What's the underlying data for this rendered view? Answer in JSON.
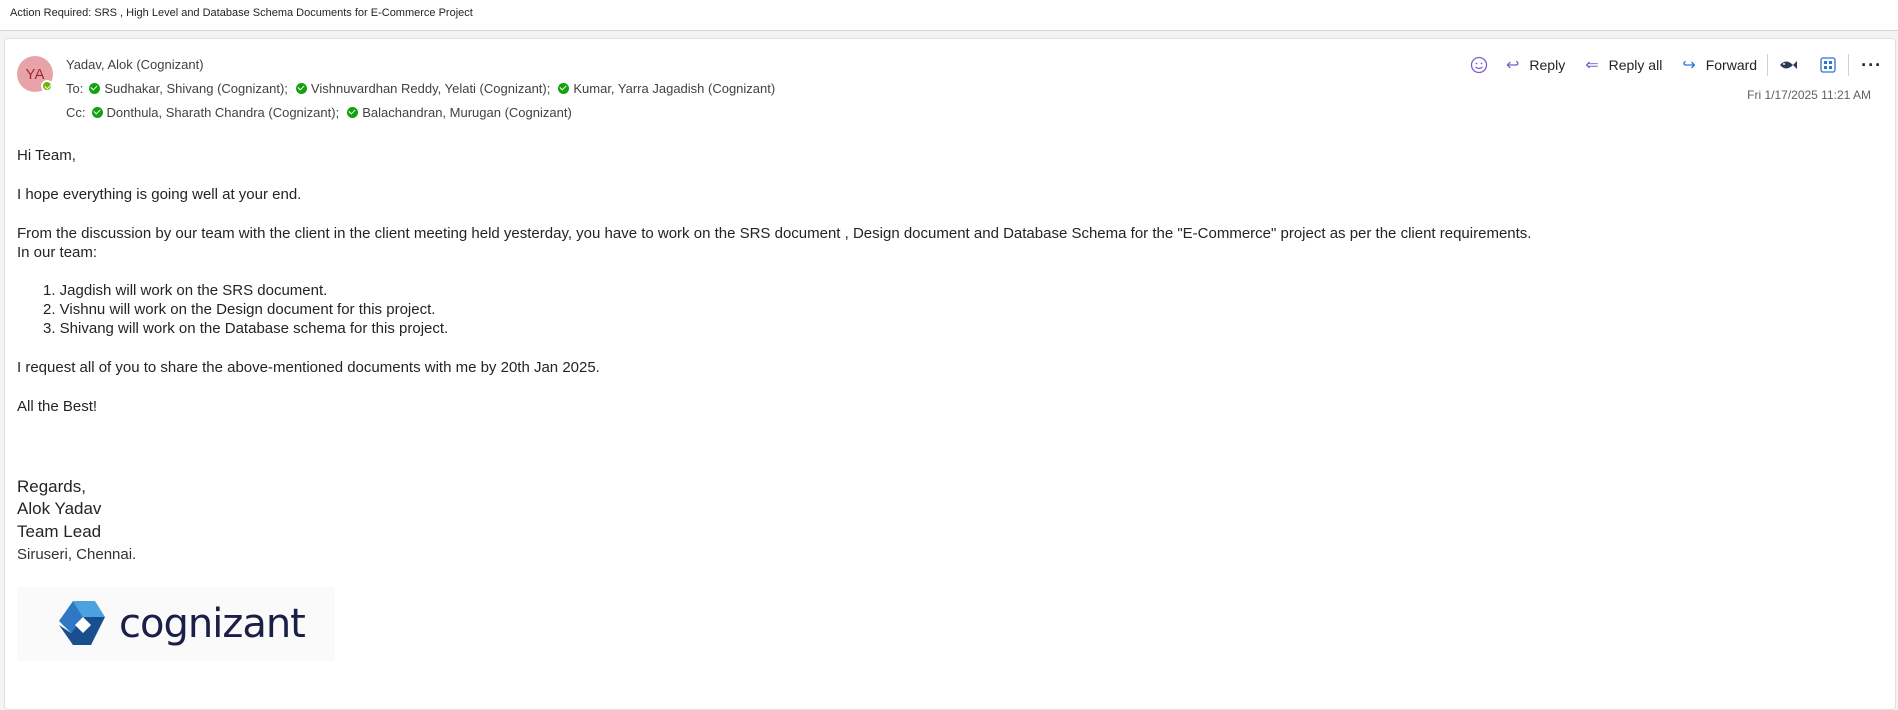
{
  "subject": "Action Required: SRS , High Level and Database Schema Documents for  E-Commerce Project",
  "sender": {
    "initials": "YA",
    "name": "Yadav, Alok (Cognizant)"
  },
  "to": {
    "label": "To:",
    "recipients": [
      "Sudhakar, Shivang (Cognizant);",
      "Vishnuvardhan Reddy, Yelati (Cognizant);",
      "Kumar, Yarra Jagadish (Cognizant)"
    ]
  },
  "cc": {
    "label": "Cc:",
    "recipients": [
      "Donthula, Sharath Chandra (Cognizant);",
      "Balachandran, Murugan (Cognizant)"
    ]
  },
  "actions": {
    "reply": "Reply",
    "reply_all": "Reply all",
    "forward": "Forward"
  },
  "timestamp": "Fri 1/17/2025 11:21 AM",
  "body": {
    "greeting": "Hi Team,",
    "line1": "I hope everything is going well at your end.",
    "line2": "From the discussion by our team with the client in the client meeting held yesterday, you have to work on the SRS document , Design document and Database Schema for the \"E-Commerce\" project as per the client requirements.",
    "line3": "In our team:",
    "list": [
      "1. Jagdish will work on the SRS document.",
      "2. Vishnu will work on the Design document for this project.",
      "3. Shivang will work on the Database schema for this project."
    ],
    "request": "I request all of you to share the above-mentioned documents with me by 20th Jan 2025.",
    "closing": "All the Best!"
  },
  "signature": {
    "regards": "Regards,",
    "name": "Alok Yadav",
    "title": "Team Lead",
    "location": "Siruseri, Chennai."
  },
  "logo": {
    "text": "cognizant",
    "colors": {
      "dark": "#1a1f47",
      "blue": "#2f78c4",
      "light": "#4aa3df"
    }
  },
  "colors": {
    "presence": "#6bb700",
    "accent": "#7b5fc8"
  }
}
